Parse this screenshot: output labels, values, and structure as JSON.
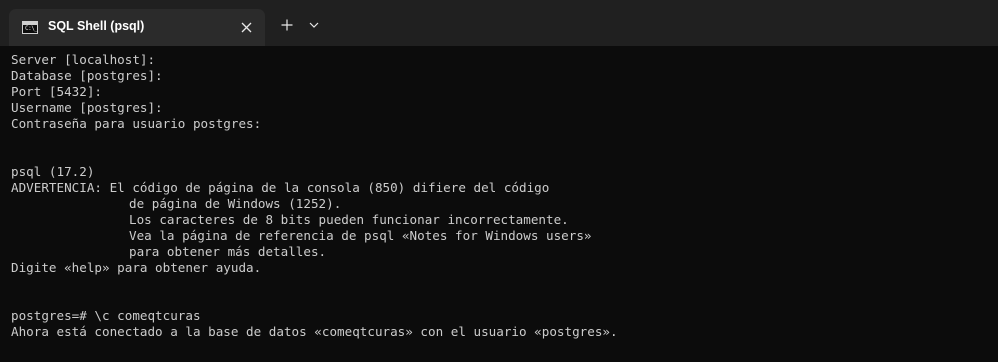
{
  "window": {
    "tab_title": "SQL Shell (psql)",
    "tab_icon_text": "C:\\_",
    "close_icon": "close-icon",
    "new_tab_icon": "plus-icon",
    "dropdown_icon": "chevron-down-icon"
  },
  "colors": {
    "titlebar_bg": "#202020",
    "tab_bg": "#2b2b2b",
    "console_bg": "#0c0c0c",
    "console_text": "#cccccc"
  },
  "console": {
    "lines": [
      "Server [localhost]:",
      "Database [postgres]:",
      "Port [5432]:",
      "Username [postgres]:",
      "Contraseña para usuario postgres:",
      "",
      "psql (17.2)",
      "ADVERTENCIA: El código de página de la consola (850) difiere del código",
      "de página de Windows (1252).",
      "Los caracteres de 8 bits pueden funcionar incorrectamente.",
      "Vea la página de referencia de psql «Notes for Windows users»",
      "para obtener más detalles.",
      "Digite «help» para obtener ayuda.",
      "",
      "postgres=# \\c comeqtcuras",
      "Ahora está conectado a la base de datos «comeqtcuras» con el usuario «postgres»."
    ]
  }
}
